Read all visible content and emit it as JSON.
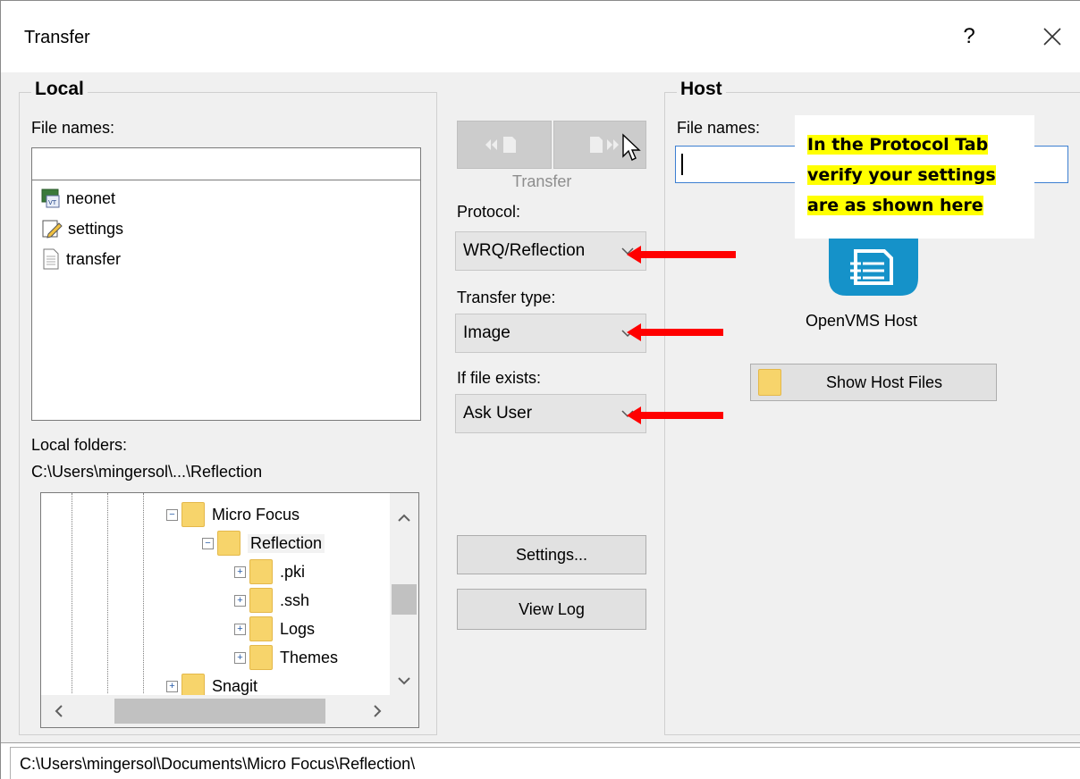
{
  "window": {
    "title": "Transfer",
    "help_label": "?"
  },
  "local": {
    "group_label": "Local",
    "file_names_label": "File names:",
    "file_names_value": "",
    "files": [
      {
        "name": "neonet",
        "icon": "reflection-session-icon"
      },
      {
        "name": "settings",
        "icon": "settings-file-icon"
      },
      {
        "name": "transfer",
        "icon": "document-icon"
      }
    ],
    "folders_label": "Local folders:",
    "current_folder": "C:\\Users\\mingersol\\...\\Reflection",
    "tree": [
      {
        "label": "Micro Focus",
        "expander": "−"
      },
      {
        "label": "Reflection",
        "expander": "−"
      },
      {
        "label": ".pki",
        "expander": "+"
      },
      {
        "label": ".ssh",
        "expander": "+"
      },
      {
        "label": "Logs",
        "expander": "+"
      },
      {
        "label": "Themes",
        "expander": "+"
      },
      {
        "label": "Snagit",
        "expander": "+"
      }
    ]
  },
  "middle": {
    "transfer_label": "Transfer",
    "protocol_label": "Protocol:",
    "protocol_value": "WRQ/Reflection",
    "transfer_type_label": "Transfer type:",
    "transfer_type_value": "Image",
    "if_exists_label": "If file exists:",
    "if_exists_value": "Ask User",
    "settings_button": "Settings...",
    "view_log_button": "View Log"
  },
  "host": {
    "group_label": "Host",
    "file_names_label": "File names:",
    "file_names_value": "",
    "host_name": "OpenVMS Host",
    "show_files_button": "Show Host Files"
  },
  "callout": {
    "lines": [
      "In the Protocol Tab",
      "verify your settings",
      "are as shown here"
    ],
    "highlight_color": "#ffff00",
    "arrow_color": "#ff0000"
  },
  "status": {
    "path": "C:\\Users\\mingersol\\Documents\\Micro Focus\\Reflection\\"
  }
}
